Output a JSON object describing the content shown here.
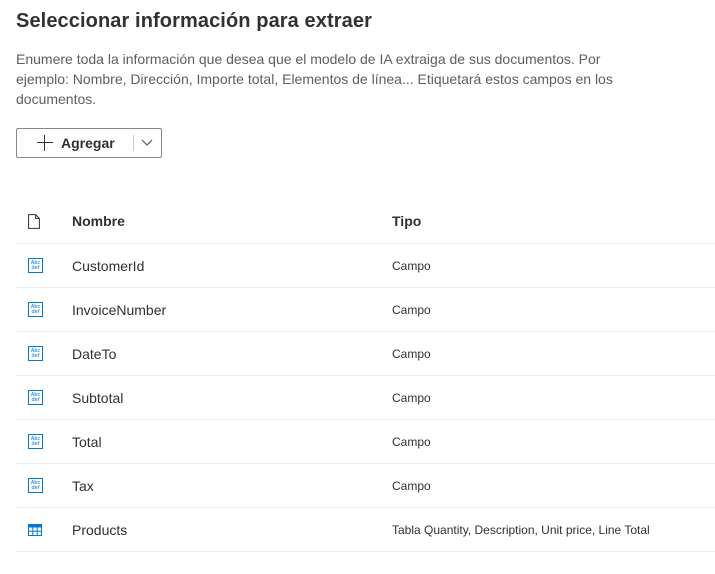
{
  "header": {
    "title": "Seleccionar información para extraer",
    "description": "Enumere toda la información que desea que el modelo de IA extraiga de sus documentos. Por ejemplo: Nombre, Dirección, Importe total, Elementos de línea... Etiquetará estos campos en los documentos."
  },
  "toolbar": {
    "add_label": "Agregar"
  },
  "table": {
    "columns": {
      "name": "Nombre",
      "type": "Tipo"
    },
    "rows": [
      {
        "name": "CustomerId",
        "type": "Campo",
        "icon": "text-field-icon"
      },
      {
        "name": "InvoiceNumber",
        "type": "Campo",
        "icon": "text-field-icon"
      },
      {
        "name": "DateTo",
        "type": "Campo",
        "icon": "text-field-icon"
      },
      {
        "name": "Subtotal",
        "type": "Campo",
        "icon": "text-field-icon"
      },
      {
        "name": "Total",
        "type": "Campo",
        "icon": "text-field-icon"
      },
      {
        "name": "Tax",
        "type": "Campo",
        "icon": "text-field-icon"
      },
      {
        "name": "Products",
        "type": "Tabla Quantity, Description, Unit price, Line Total",
        "icon": "table-icon"
      }
    ]
  },
  "colors": {
    "accent": "#0078d4",
    "text": "#323130",
    "secondary_text": "#605e5c",
    "divider": "#edebe9"
  },
  "icons": {
    "abc_top": "Abc",
    "abc_bottom": "def"
  }
}
